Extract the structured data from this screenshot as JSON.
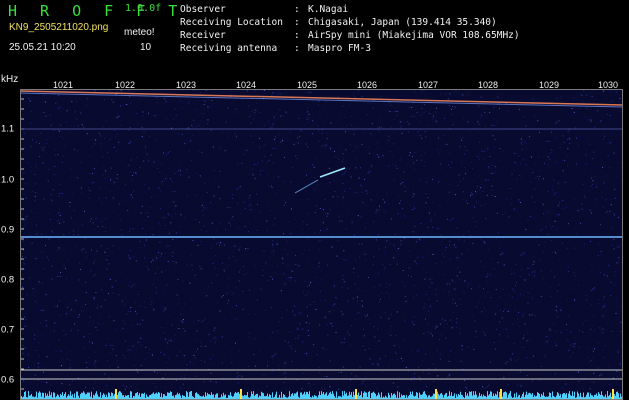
{
  "header": {
    "app_title": "H R O F F T",
    "version": "1.0.0f",
    "file_name": "KN9_2505211020.png",
    "datetime": "25.05.21 10:20",
    "count_label": "meteo!",
    "count_value": "10",
    "info": [
      {
        "key": "Observer",
        "value": "K.Nagai"
      },
      {
        "key": "Receiving Location",
        "value": "Chigasaki, Japan (139.414 35.340)"
      },
      {
        "key": "Receiver",
        "value": "AirSpy mini (Miakejima VOR 108.65MHz)"
      },
      {
        "key": "Receiving antenna",
        "value": "Maspro FM-3"
      }
    ]
  },
  "axes": {
    "y_unit": "kHz",
    "top_ticks": [
      "1021",
      "1022",
      "1023",
      "1024",
      "1025",
      "1026",
      "1027",
      "1028",
      "1029",
      "1030"
    ],
    "y_ticks": [
      "1.1",
      "1.0",
      "0.9",
      "0.8",
      "0.7",
      "0.6"
    ]
  },
  "colors": {
    "background": "#000000",
    "spectrogram_bg": "#090a30",
    "title_green": "#38e038",
    "filename_yellow": "#f0e060",
    "carrier_line": "#6fb6ff",
    "reference_line": "#c9c9c9",
    "meteor_trace": "#9fe8ff",
    "activity_bar": "#4fd0ff"
  }
}
